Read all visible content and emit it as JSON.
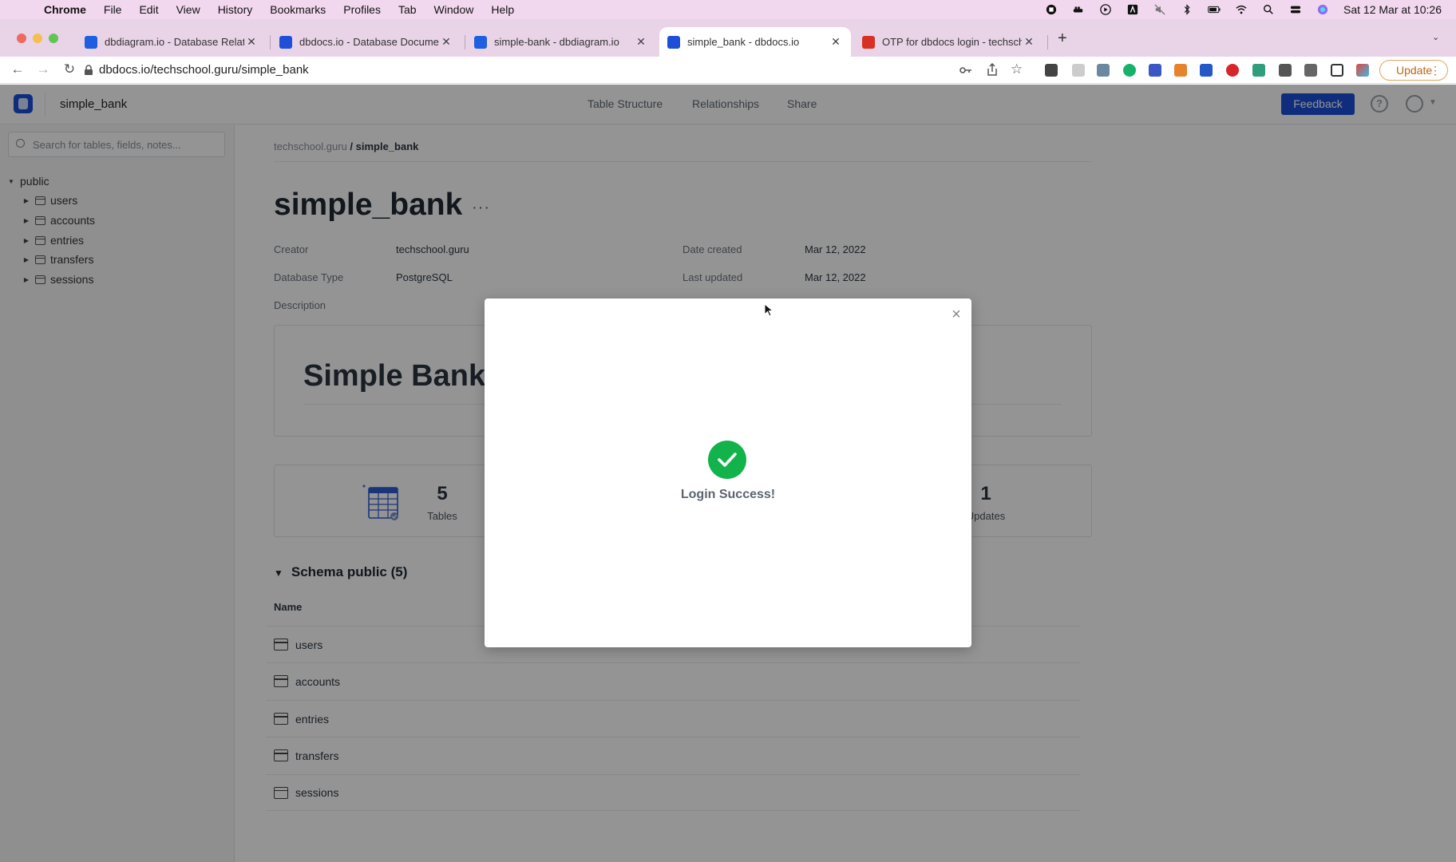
{
  "menubar": {
    "app": "Chrome",
    "items": [
      "File",
      "Edit",
      "View",
      "History",
      "Bookmarks",
      "Profiles",
      "Tab",
      "Window",
      "Help"
    ],
    "clock": "Sat 12 Mar at  10:26"
  },
  "tabs": [
    {
      "title": "dbdiagram.io - Database Relati",
      "active": false,
      "favicon_color": "#1d5fe0"
    },
    {
      "title": "dbdocs.io - Database Docume",
      "active": false,
      "favicon_color": "#1d4fd8"
    },
    {
      "title": "simple-bank - dbdiagram.io",
      "active": false,
      "favicon_color": "#1d5fe0"
    },
    {
      "title": "simple_bank - dbdocs.io",
      "active": true,
      "favicon_color": "#1d4fd8"
    },
    {
      "title": "OTP for dbdocs login - techsch",
      "active": false,
      "favicon_color": "#d93025"
    }
  ],
  "toolbar": {
    "url": "dbdocs.io/techschool.guru/simple_bank",
    "update_label": "Update"
  },
  "header": {
    "project": "simple_bank",
    "nav": [
      "Table Structure",
      "Relationships",
      "Share"
    ],
    "feedback_label": "Feedback",
    "help_glyph": "?"
  },
  "sidebar": {
    "search_placeholder": "Search for tables, fields, notes...",
    "schema": "public",
    "tables": [
      "users",
      "accounts",
      "entries",
      "transfers",
      "sessions"
    ]
  },
  "main": {
    "breadcrumb_owner": "techschool.guru",
    "breadcrumb_sep": " / ",
    "breadcrumb_project": "simple_bank",
    "title": "simple_bank",
    "more_glyph": "···",
    "creator_label": "Creator",
    "creator": "techschool.guru",
    "db_type_label": "Database Type",
    "db_type": "PostgreSQL",
    "date_created_label": "Date created",
    "date_created": "Mar 12, 2022",
    "last_updated_label": "Last updated",
    "last_updated": "Mar 12, 2022",
    "description_label": "Description",
    "description_heading": "Simple Bank",
    "stats": {
      "tables_count": "5",
      "tables_label": "Tables",
      "updates_count": "1",
      "updates_label": "Updates"
    },
    "schema_heading": "Schema public (5)",
    "column_header": "Name",
    "tables": [
      "users",
      "accounts",
      "entries",
      "transfers",
      "sessions"
    ]
  },
  "modal": {
    "message": "Login Success!",
    "close_glyph": "×"
  }
}
